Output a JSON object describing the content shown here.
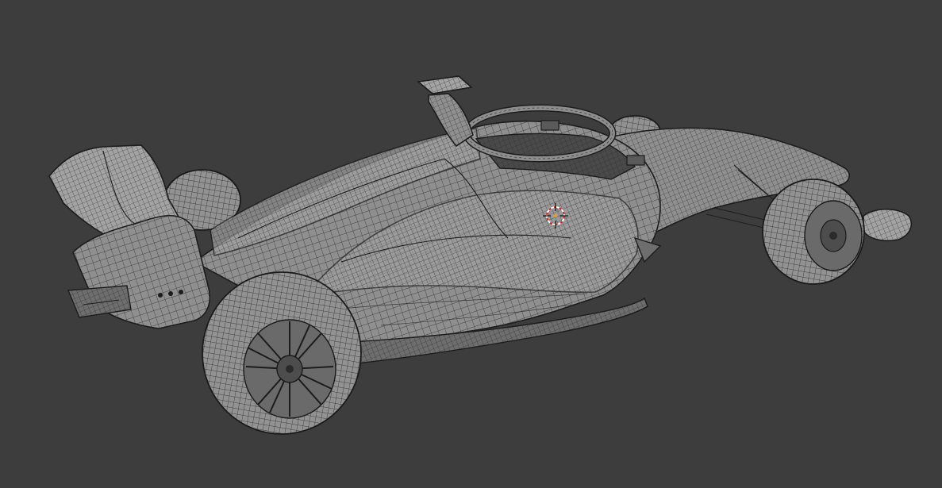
{
  "viewport": {
    "background": "#3d3d3d",
    "shading": "wireframe-solid",
    "object": "formula-car-mesh"
  },
  "cursor3d": {
    "colors": [
      "#e02020",
      "#ffffff"
    ],
    "icon": "3d-cursor-icon"
  }
}
